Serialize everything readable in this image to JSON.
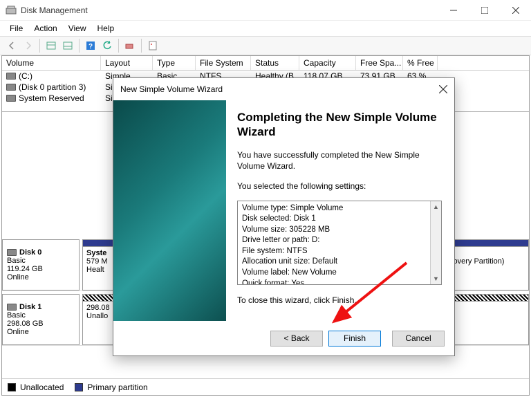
{
  "window": {
    "title": "Disk Management"
  },
  "menu": {
    "file": "File",
    "action": "Action",
    "view": "View",
    "help": "Help"
  },
  "columns": {
    "volume": "Volume",
    "layout": "Layout",
    "type": "Type",
    "fs": "File System",
    "status": "Status",
    "capacity": "Capacity",
    "free": "Free Spa...",
    "pct": "% Free"
  },
  "volumes": [
    {
      "name": "(C:)",
      "layout": "Simple",
      "type": "Basic",
      "fs": "NTFS",
      "status": "Healthy (B...",
      "capacity": "118.07 GB",
      "free": "73.91 GB",
      "pct": "63 %"
    },
    {
      "name": "(Disk 0 partition 3)",
      "layout": "Si",
      "type": "",
      "fs": "",
      "status": "",
      "capacity": "",
      "free": "",
      "pct": ""
    },
    {
      "name": "System Reserved",
      "layout": "Si",
      "type": "",
      "fs": "",
      "status": "",
      "capacity": "",
      "free": "",
      "pct": ""
    }
  ],
  "disks": [
    {
      "label": "Disk 0",
      "type": "Basic",
      "size": "119.24 GB",
      "state": "Online",
      "part0": {
        "name": "Syste",
        "size": "579 M",
        "status": "Healt"
      },
      "recovery": "covery Partition)"
    },
    {
      "label": "Disk 1",
      "type": "Basic",
      "size": "298.08 GB",
      "state": "Online",
      "part0": {
        "size": "298.08",
        "status": "Unallo"
      }
    }
  ],
  "legend": {
    "unallocated": "Unallocated",
    "primary": "Primary partition"
  },
  "wizard": {
    "title": "New Simple Volume Wizard",
    "heading": "Completing the New Simple Volume Wizard",
    "p1": "You have successfully completed the New Simple Volume Wizard.",
    "p2": "You selected the following settings:",
    "settings": [
      "Volume type: Simple Volume",
      "Disk selected: Disk 1",
      "Volume size: 305228 MB",
      "Drive letter or path: D:",
      "File system: NTFS",
      "Allocation unit size: Default",
      "Volume label: New Volume",
      "Quick format: Yes"
    ],
    "p3": "To close this wizard, click Finish.",
    "back": "< Back",
    "finish": "Finish",
    "cancel": "Cancel"
  }
}
